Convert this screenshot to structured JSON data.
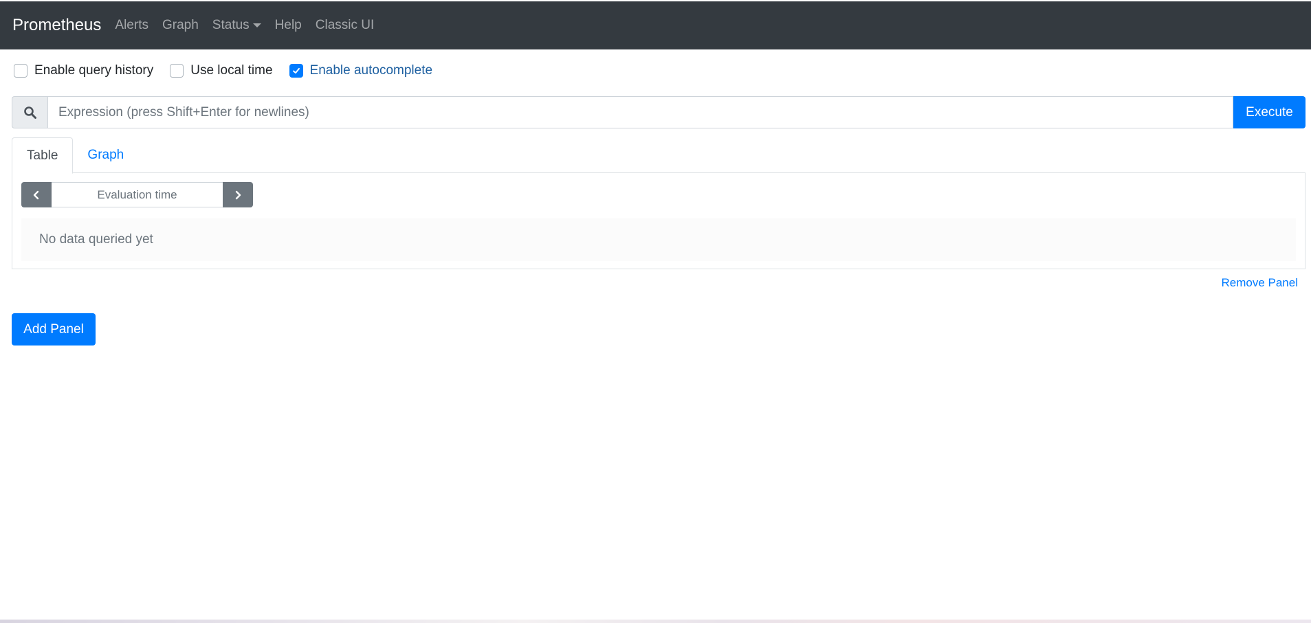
{
  "navbar": {
    "brand": "Prometheus",
    "links": [
      {
        "label": "Alerts"
      },
      {
        "label": "Graph"
      },
      {
        "label": "Status"
      },
      {
        "label": "Help"
      },
      {
        "label": "Classic UI"
      }
    ]
  },
  "options": {
    "query_history": {
      "label": "Enable query history",
      "checked": false
    },
    "local_time": {
      "label": "Use local time",
      "checked": false
    },
    "autocomplete": {
      "label": "Enable autocomplete",
      "checked": true
    }
  },
  "expression": {
    "placeholder": "Expression (press Shift+Enter for newlines)",
    "value": "",
    "search_icon": "search-icon",
    "execute_label": "Execute"
  },
  "panel": {
    "tabs": [
      {
        "label": "Table",
        "active": true
      },
      {
        "label": "Graph",
        "active": false
      }
    ],
    "eval_time_placeholder": "Evaluation time",
    "no_data_text": "No data queried yet",
    "remove_label": "Remove Panel"
  },
  "add_panel_label": "Add Panel",
  "colors": {
    "navbar_bg": "#343a40",
    "primary": "#007bff",
    "secondary": "#6c757d"
  }
}
